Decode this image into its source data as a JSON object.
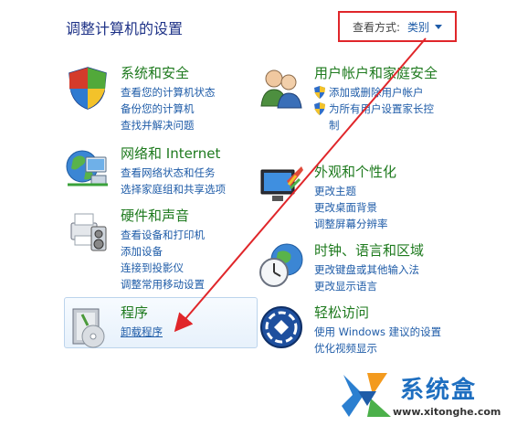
{
  "page_title": "调整计算机的设置",
  "view_by": {
    "label": "查看方式:",
    "value": "类别"
  },
  "categories": [
    {
      "title": "系统和安全",
      "links": [
        "查看您的计算机状态",
        "备份您的计算机",
        "查找并解决问题"
      ]
    },
    {
      "title": "网络和 Internet",
      "links": [
        "查看网络状态和任务",
        "选择家庭组和共享选项"
      ]
    },
    {
      "title": "硬件和声音",
      "links": [
        "查看设备和打印机",
        "添加设备",
        "连接到投影仪",
        "调整常用移动设置"
      ]
    },
    {
      "title": "程序",
      "links": [
        "卸载程序"
      ]
    },
    {
      "title": "用户帐户和家庭安全",
      "links": [
        "添加或删除用户帐户",
        "为所有用户设置家长控制"
      ]
    },
    {
      "title": "外观和个性化",
      "links": [
        "更改主题",
        "更改桌面背景",
        "调整屏幕分辨率"
      ]
    },
    {
      "title": "时钟、语言和区域",
      "links": [
        "更改键盘或其他输入法",
        "更改显示语言"
      ]
    },
    {
      "title": "轻松访问",
      "links": [
        "使用 Windows 建议的设置",
        "优化视频显示"
      ]
    }
  ],
  "watermark": {
    "brand": "系统盒",
    "url": "www.xitonghe.com"
  },
  "colors": {
    "accent_red": "#e0262a",
    "link_blue": "#1f5ca8",
    "title_green": "#1e7a1e"
  }
}
